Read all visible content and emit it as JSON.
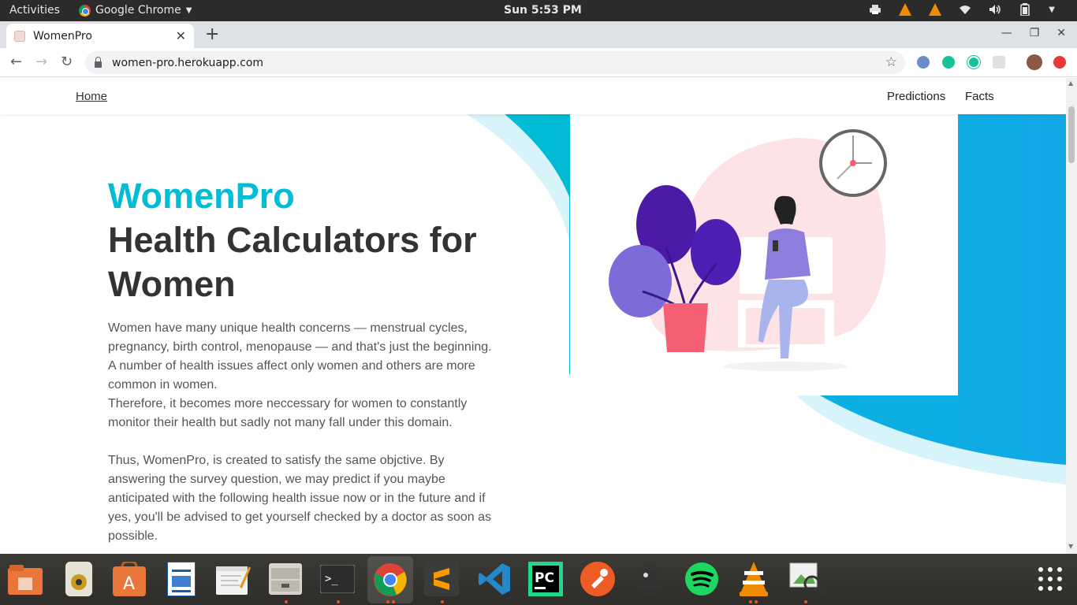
{
  "system_bar": {
    "activities": "Activities",
    "app_name": "Google Chrome",
    "clock": "Sun  5:53 PM"
  },
  "browser": {
    "tab_title": "WomenPro",
    "url": "women-pro.herokuapp.com"
  },
  "navbar": {
    "home": "Home",
    "predictions": "Predictions",
    "facts": "Facts"
  },
  "hero": {
    "brand": "WomenPro",
    "headline": "Health Calculators for Women",
    "paragraph1": "Women have many unique health concerns — menstrual cycles, pregnancy, birth control, menopause — and that's just the beginning. A number of health issues affect only women and others are more common in women.",
    "paragraph1b": "Therefore, it becomes more neccessary for women to constantly monitor their health but sadly not many fall under this domain.",
    "paragraph2": "Thus, WomenPro, is created to satisfy the same objctive. By answering the survey question, we may predict if you maybe anticipated with the following health issue now or in the future and if yes, you'll be advised to get yourself checked by a doctor as soon as possible."
  },
  "colors": {
    "brand_cyan": "#00bcd4",
    "heading": "#333333",
    "blob_pink": "#fde2e6",
    "plant_purple": "#4b1ba8",
    "pot_pink": "#f45f74",
    "shirt_lilac": "#8f7dde"
  },
  "dock": {
    "items": [
      "files-icon",
      "rhythmbox-icon",
      "software-center-icon",
      "writer-icon",
      "text-editor-icon",
      "archive-icon",
      "terminal-icon",
      "chrome-icon",
      "sublime-icon",
      "vscode-icon",
      "pycharm-icon",
      "postman-icon",
      "mines-icon",
      "spotify-icon",
      "vlc-icon",
      "image-viewer-icon",
      "app-grid-icon"
    ]
  }
}
